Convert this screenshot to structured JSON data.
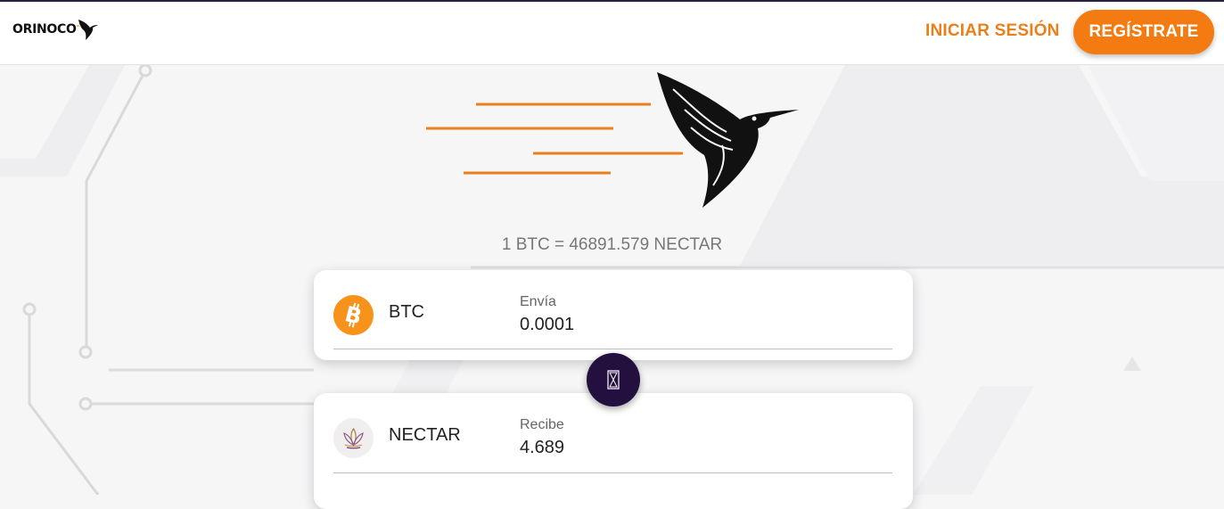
{
  "header": {
    "logo_text": "ORINOCO",
    "login_label": "INICIAR SESIÓN",
    "register_label": "REGÍSTRATE"
  },
  "exchange": {
    "rate_text": "1 BTC = 46891.579 NECTAR",
    "send": {
      "coin": "BTC",
      "label": "Envía",
      "value": "0.0001",
      "icon": "bitcoin-icon"
    },
    "receive": {
      "coin": "NECTAR",
      "label": "Recibe",
      "value": "4.689",
      "icon": "lotus-icon"
    },
    "swap_icon": "hourglass-icon"
  },
  "colors": {
    "accent": "#f47b12",
    "link": "#e8801b",
    "swap_bg": "#24103f",
    "bitcoin": "#f7931a"
  }
}
